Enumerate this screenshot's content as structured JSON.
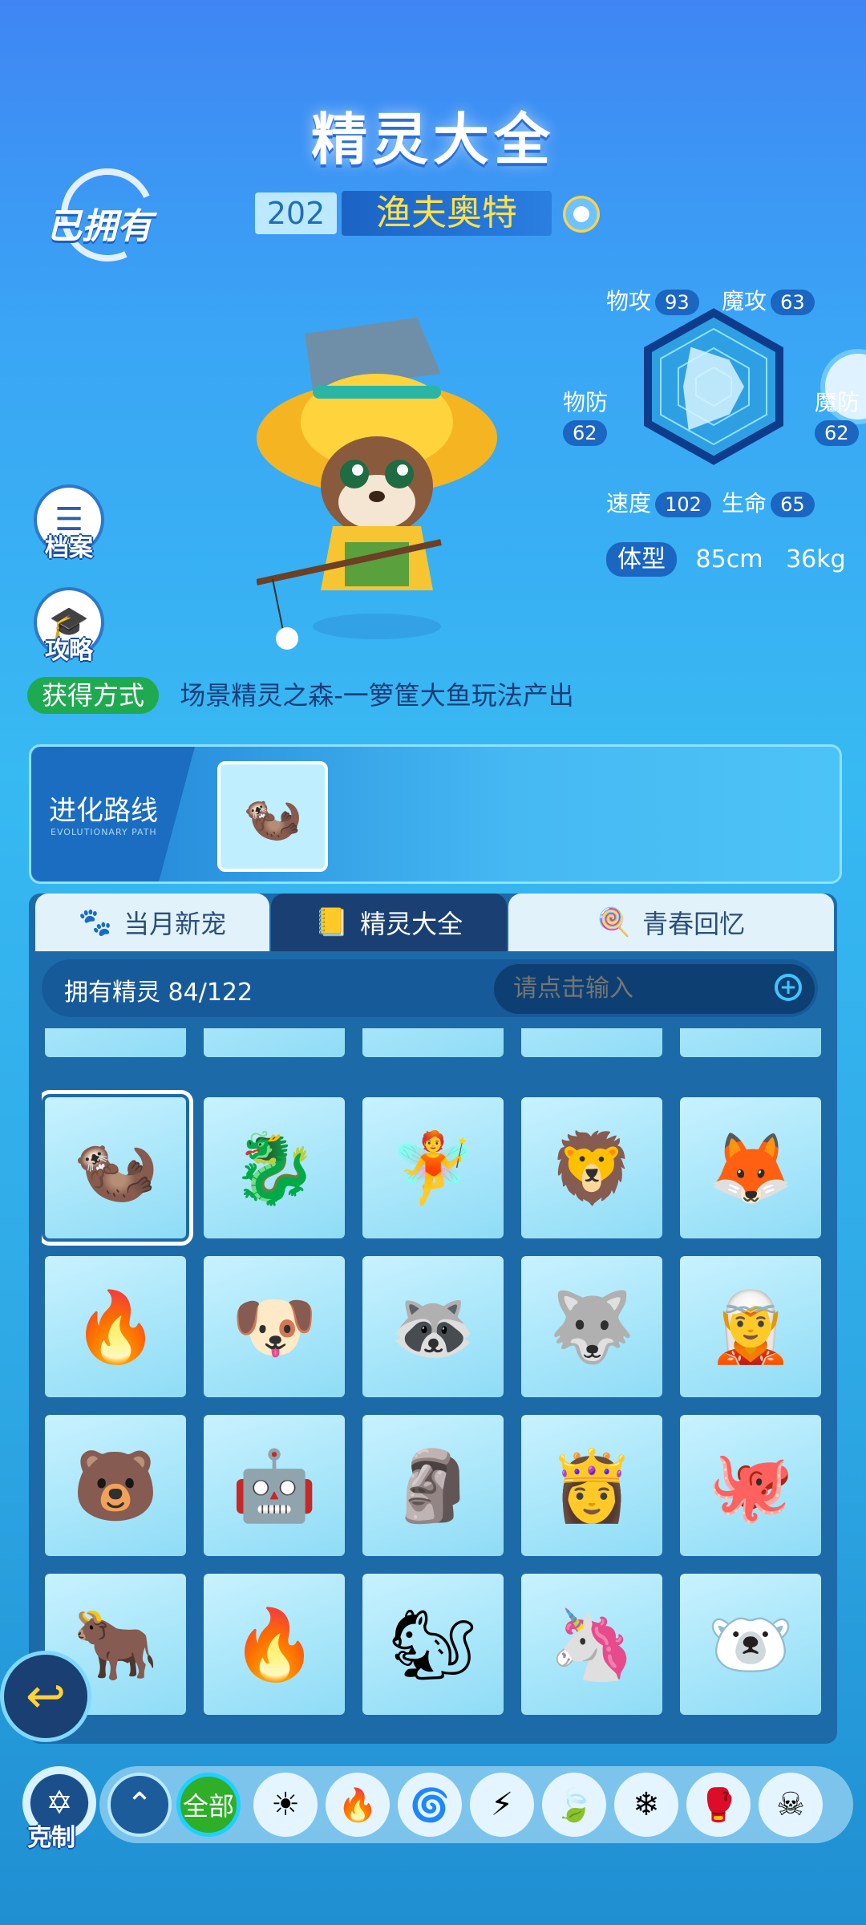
{
  "header": {
    "title": "精灵大全",
    "owned_badge": "已拥有"
  },
  "pet": {
    "number": "202",
    "name": "渔夫奥特",
    "attribute_icon": "water-element-icon",
    "art": "fisher-otter-pet"
  },
  "stats": {
    "phys_atk_label": "物攻",
    "phys_atk": "93",
    "mag_atk_label": "魔攻",
    "mag_atk": "63",
    "phys_def_label": "物防",
    "phys_def": "62",
    "mag_def_label": "魔防",
    "mag_def": "62",
    "speed_label": "速度",
    "speed": "102",
    "hp_label": "生命",
    "hp": "65"
  },
  "body_type": {
    "label": "体型",
    "height": "85cm",
    "weight": "36kg"
  },
  "side_buttons": {
    "archive": "档案",
    "guide": "攻略"
  },
  "obtain": {
    "label": "获得方式",
    "text": "场景精灵之森-一箩筐大鱼玩法产出"
  },
  "evolution": {
    "title": "进化路线",
    "subtitle": "EVOLUTIONARY PATH"
  },
  "tabs": [
    {
      "label": "当月新宠",
      "icon": "paw-icon"
    },
    {
      "label": "精灵大全",
      "icon": "book-icon"
    },
    {
      "label": "青春回忆",
      "icon": "lollipop-icon"
    }
  ],
  "collection": {
    "owned_label": "拥有精灵",
    "owned_count": "84/122",
    "search_placeholder": "请点击输入"
  },
  "grid_pets": [
    "🦦",
    "🐉",
    "🧚",
    "🦁",
    "🦊",
    "🔥",
    "🐶",
    "🦝",
    "🐺",
    "🧝",
    "🐻",
    "🤖",
    "🗿",
    "👸",
    "🐙",
    "🐂",
    "🔥",
    "🐿",
    "🦄",
    "🐻‍❄"
  ],
  "bottom": {
    "counter_label": "克制",
    "all_label": "全部",
    "filters": [
      "light-icon",
      "fire-icon",
      "water-icon",
      "electric-icon",
      "grass-icon",
      "ice-icon",
      "fighting-icon",
      "poison-icon"
    ]
  },
  "colors": {
    "accent": "#1b66c0",
    "name_gold": "#ffe14a",
    "obtain_green": "#1faa52"
  }
}
